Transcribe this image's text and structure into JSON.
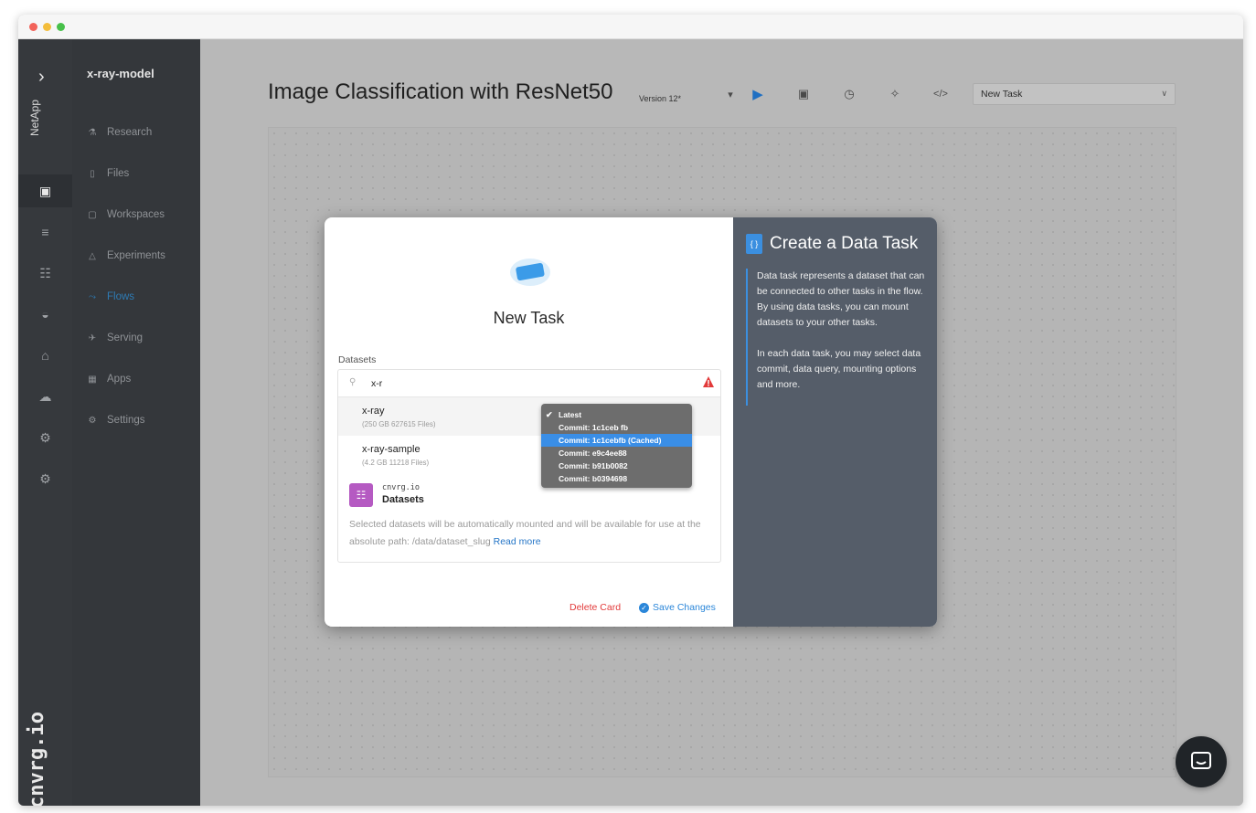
{
  "sidebar": {
    "brand": "NetApp",
    "logo_text": "cnvrg.io",
    "project_name": "x-ray-model",
    "nav": [
      {
        "label": "Research",
        "icon": "lab-icon"
      },
      {
        "label": "Files",
        "icon": "file-icon"
      },
      {
        "label": "Workspaces",
        "icon": "workspace-icon"
      },
      {
        "label": "Experiments",
        "icon": "flask-icon"
      },
      {
        "label": "Flows",
        "icon": "flow-icon"
      },
      {
        "label": "Serving",
        "icon": "rocket-icon"
      },
      {
        "label": "Apps",
        "icon": "grid-icon"
      },
      {
        "label": "Settings",
        "icon": "gear-icon"
      }
    ],
    "active_nav": "Flows"
  },
  "header": {
    "title": "Image Classification with ResNet50",
    "version": "Version 12*",
    "task_select": "New Task"
  },
  "modal": {
    "title": "New Task",
    "datasets_label": "Datasets",
    "search_value": "x-r",
    "datasets": [
      {
        "name": "x-ray",
        "meta": "(250 GB 627615 Files)"
      },
      {
        "name": "x-ray-sample",
        "meta": "(4.2 GB 11218 Files)"
      }
    ],
    "commit_options": [
      {
        "label": "Latest",
        "checked": true
      },
      {
        "label": "Commit: 1c1ceb fb"
      },
      {
        "label": "Commit: 1c1cebfb (Cached)",
        "highlighted": true
      },
      {
        "label": "Commit: e9c4ee88"
      },
      {
        "label": "Commit: b91b0082"
      },
      {
        "label": "Commit: b0394698"
      }
    ],
    "source_name": "cnvrg.io",
    "source_sub": "Datasets",
    "note": "Selected datasets will be automatically mounted and will be available for use at the absolute path: /data/dataset_slug",
    "read_more": "Read more",
    "delete_label": "Delete Card",
    "save_label": "Save Changes"
  },
  "info_panel": {
    "title": "Create a Data Task",
    "para1": "Data task represents a dataset that can be connected to other tasks in the flow. By using data tasks, you can mount datasets to your other tasks.",
    "para2": "In each data task, you may select data commit, data query, mounting options and more."
  },
  "colors": {
    "accent": "#3b8fe0",
    "danger": "#e23a3a",
    "sidebar_bg": "#34373b",
    "info_panel_bg": "#555d69"
  }
}
